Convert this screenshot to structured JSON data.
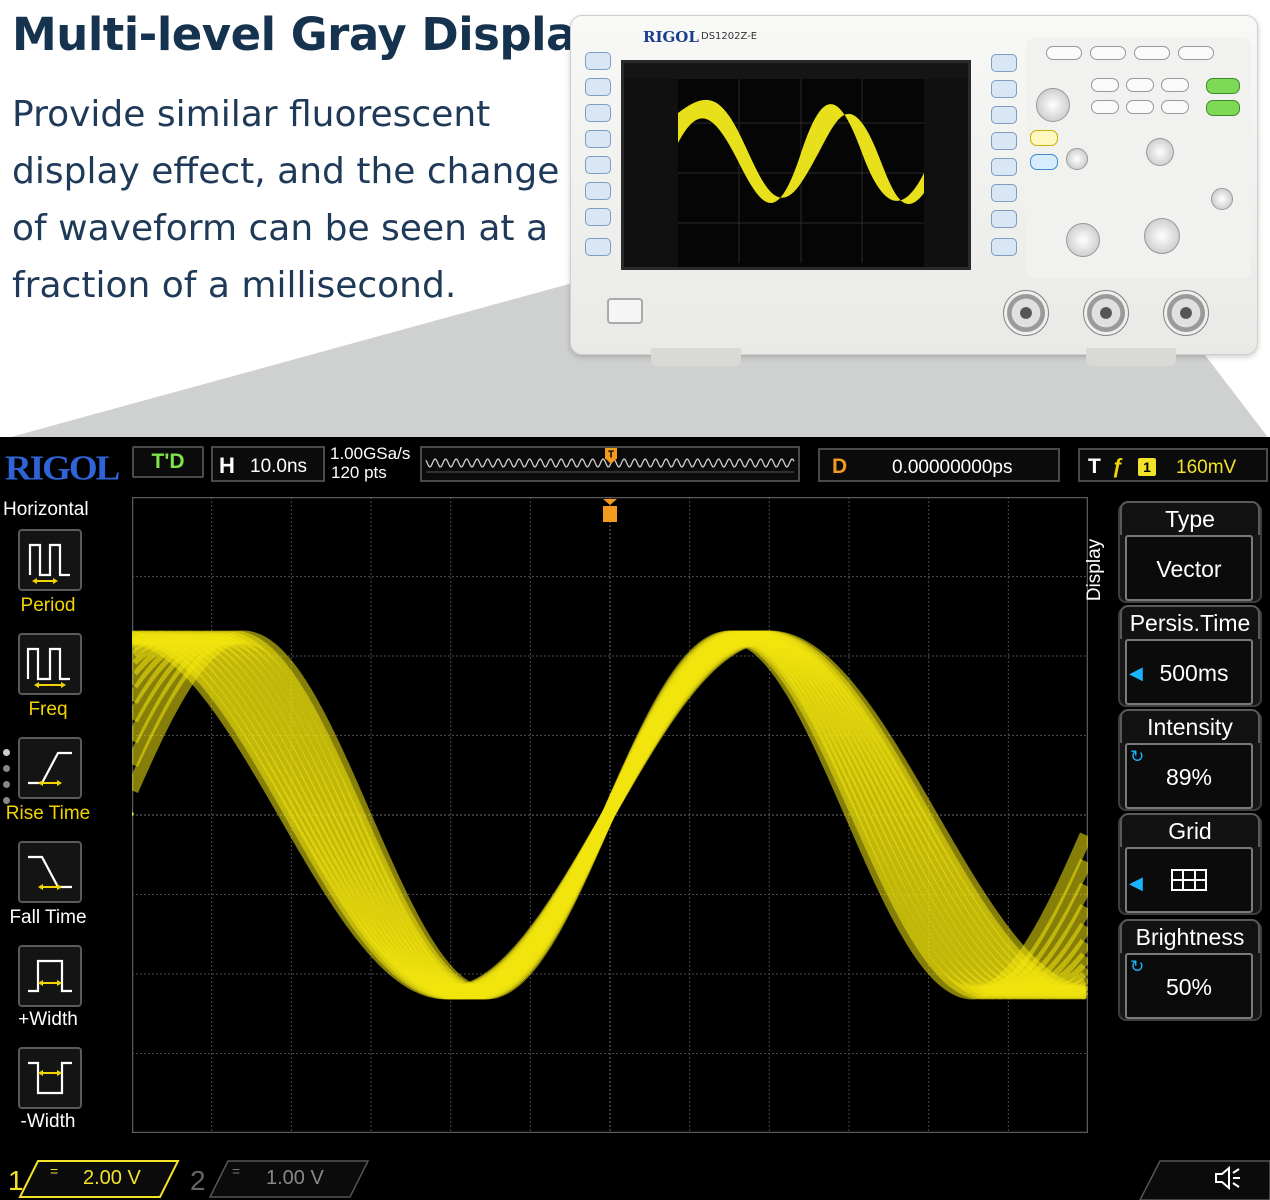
{
  "promo": {
    "headline": "Multi-level Gray Display",
    "description": "Provide similar fluorescent display effect, and the change of waveform can be seen at a fraction of a millisecond."
  },
  "device": {
    "brand": "RIGOL",
    "model": "DS1202Z-E"
  },
  "scope": {
    "brand": "RIGOL",
    "run_state": "T'D",
    "horizontal": {
      "label": "H",
      "timebase": "10.0ns"
    },
    "sample_rate": "1.00GSa/s",
    "memory_depth": "120 pts",
    "delay": {
      "label": "D",
      "value": "0.00000000ps"
    },
    "trigger": {
      "label": "T",
      "source": "1",
      "level": "160mV"
    },
    "left_menu": {
      "title": "Horizontal",
      "items": [
        {
          "label": "Period",
          "icon": "period-icon"
        },
        {
          "label": "Freq",
          "icon": "frequency-icon"
        },
        {
          "label": "Rise Time",
          "icon": "rise-time-icon"
        },
        {
          "label": "Fall Time",
          "icon": "fall-time-icon"
        },
        {
          "label": "+Width",
          "icon": "positive-width-icon"
        },
        {
          "label": "-Width",
          "icon": "negative-width-icon"
        }
      ]
    },
    "ch1_marker": "1",
    "trigger_marker": "T",
    "right_menu": {
      "tab": "Display",
      "items": [
        {
          "label": "Type",
          "value": "Vector",
          "indicator": ""
        },
        {
          "label": "Persis.Time",
          "value": "500ms",
          "indicator": "arrow"
        },
        {
          "label": "Intensity",
          "value": "89%",
          "indicator": "swirl"
        },
        {
          "label": "Grid",
          "value": "",
          "indicator": "arrow"
        },
        {
          "label": "Brightness",
          "value": "50%",
          "indicator": "swirl"
        }
      ]
    },
    "channels": [
      {
        "num": "1",
        "coupling": "=",
        "scale": "2.00 V",
        "color": "#f2e32a",
        "active": true
      },
      {
        "num": "2",
        "coupling": "=",
        "scale": "1.00 V",
        "color": "#888888",
        "active": false
      }
    ],
    "colors": {
      "waveform": "#f2e60f",
      "accent_orange": "#f39a1e",
      "accent_blue": "#1ab3ff",
      "menu_yellow": "#f2d400",
      "logo_blue": "#2f63d8"
    }
  }
}
